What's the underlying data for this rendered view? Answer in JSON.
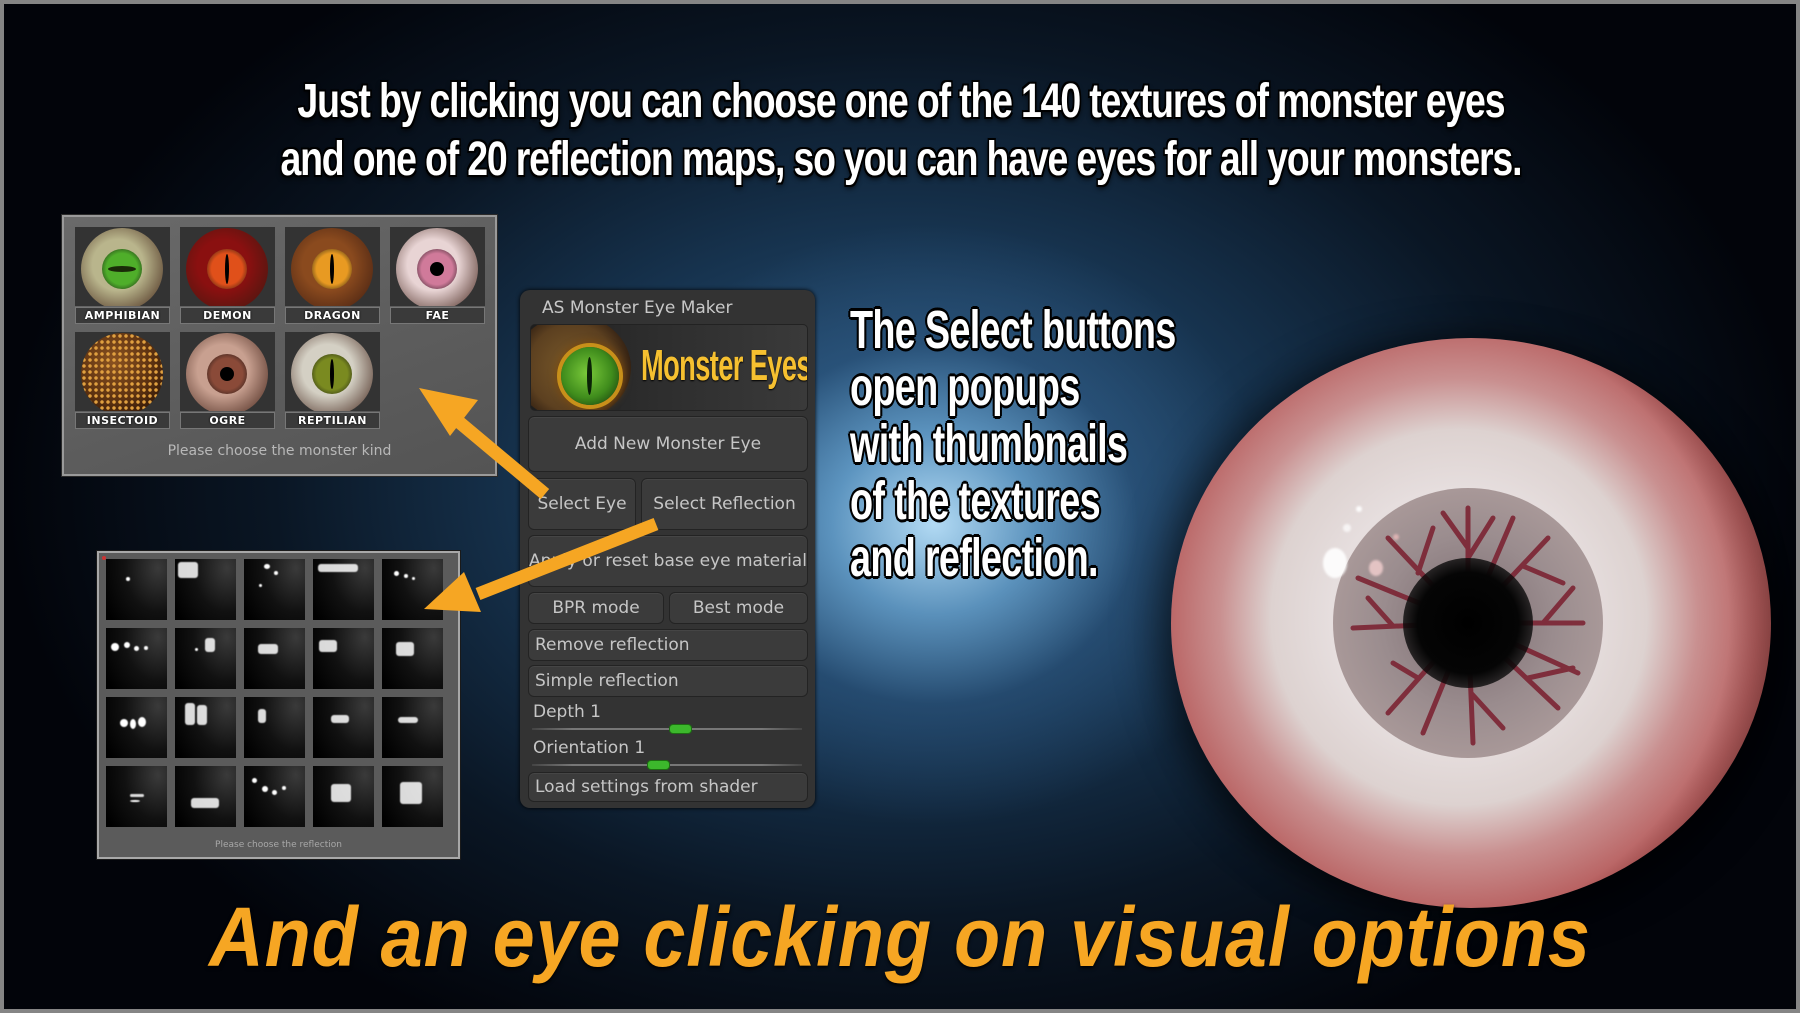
{
  "headline": {
    "line1": "Just by clicking you can choose one of the 140 textures of monster eyes",
    "line2": "and one of 20 reflection maps, so you can have eyes for all your monsters."
  },
  "monster_popup": {
    "kinds": [
      {
        "label": "AMPHIBIAN",
        "iris": "#4fae2a",
        "ball": "#b9b58c",
        "pupil": "slit-horizontal"
      },
      {
        "label": "DEMON",
        "iris": "#e0501a",
        "ball": "#8a1010",
        "pupil": "slit-vertical"
      },
      {
        "label": "DRAGON",
        "iris": "#e89a22",
        "ball": "#8a4a1e",
        "pupil": "slit-vertical"
      },
      {
        "label": "FAE",
        "iris": "#d07a9a",
        "ball": "#e8d4d4",
        "pupil": "round"
      },
      {
        "label": "INSECTOID",
        "iris": "#8a5220",
        "ball": "#6a3a12",
        "pupil": "none"
      },
      {
        "label": "OGRE",
        "iris": "#8a4a38",
        "ball": "#c8a090",
        "pupil": "round"
      },
      {
        "label": "REPTILIAN",
        "iris": "#7a8a20",
        "ball": "#d4d0c4",
        "pupil": "slit-vertical"
      }
    ],
    "hint": "Please choose the monster kind"
  },
  "reflection_popup": {
    "count": 20,
    "hint": "Please choose the reflection"
  },
  "control_panel": {
    "title": "AS Monster Eye Maker",
    "banner_text": "Monster Eyes",
    "add_button": "Add New Monster Eye",
    "select_eye": "Select Eye",
    "select_reflection": "Select Reflection",
    "apply_reset": "Apply or reset base eye material",
    "bpr_mode": "BPR mode",
    "best_mode": "Best mode",
    "remove_reflection": "Remove reflection",
    "simple_reflection": "Simple reflection",
    "depth_label": "Depth 1",
    "depth_value": 0.55,
    "orientation_label": "Orientation 1",
    "orientation_value": 0.46,
    "load_settings": "Load settings from shader"
  },
  "callout": {
    "lines": [
      "The Select buttons",
      "open popups",
      "with thumbnails",
      "of the textures",
      "and reflection."
    ]
  },
  "tagline": "And an eye clicking on visual options",
  "colors": {
    "accent_orange": "#F6A623",
    "banner_yellow": "#F6C030",
    "slider_green": "#3CB82C",
    "panel_bg": "#333333",
    "frame_gray": "#858585"
  }
}
